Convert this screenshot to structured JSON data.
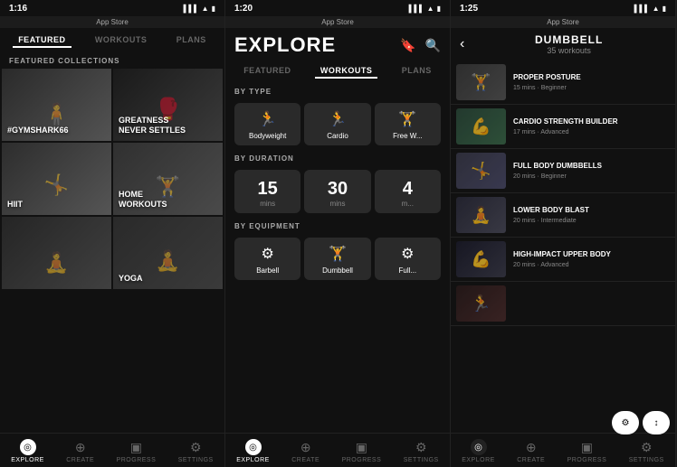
{
  "panels": [
    {
      "id": "panel1",
      "statusBar": {
        "time": "1:16",
        "carrier": "App Store"
      },
      "navTabs": [
        {
          "label": "FEATURED",
          "active": true
        },
        {
          "label": "WORKOUTS",
          "active": false
        },
        {
          "label": "PLANS",
          "active": false
        }
      ],
      "sectionLabel": "FEATURED COLLECTIONS",
      "cards": [
        {
          "label": "#GYMSHARK66",
          "bgClass": "bg-gymshark"
        },
        {
          "label": "GREATNESS\nNEVER SETTLES",
          "bgClass": "bg-greatness"
        },
        {
          "label": "HIIT",
          "bgClass": "bg-hiit"
        },
        {
          "label": "HOME\nWORKOUTS",
          "bgClass": "bg-home"
        },
        {
          "label": "",
          "bgClass": "bg-yoga"
        },
        {
          "label": "YOGA",
          "bgClass": "bg-extra"
        }
      ],
      "bottomNav": [
        {
          "label": "EXPLORE",
          "icon": "⊙",
          "active": true
        },
        {
          "label": "CREATE",
          "icon": "⊕",
          "active": false
        },
        {
          "label": "PROGRESS",
          "icon": "▣",
          "active": false
        },
        {
          "label": "SETTINGS",
          "icon": "⚙",
          "active": false
        }
      ]
    },
    {
      "id": "panel2",
      "statusBar": {
        "time": "1:20",
        "carrier": "App Store"
      },
      "title": "EXPLORE",
      "navTabs": [
        {
          "label": "FEATURED",
          "active": false
        },
        {
          "label": "WORKOUTS",
          "active": true
        },
        {
          "label": "PLANS",
          "active": false
        }
      ],
      "sections": {
        "byType": {
          "label": "BY TYPE",
          "items": [
            {
              "icon": "🏃",
              "label": "Bodyweight"
            },
            {
              "icon": "🏃",
              "label": "Cardio"
            },
            {
              "icon": "🏋",
              "label": "Free W..."
            }
          ]
        },
        "byDuration": {
          "label": "BY DURATION",
          "items": [
            {
              "num": "15",
              "unit": "mins"
            },
            {
              "num": "30",
              "unit": "mins"
            },
            {
              "num": "4",
              "unit": "m..."
            }
          ]
        },
        "byEquipment": {
          "label": "BY EQUIPMENT",
          "items": [
            {
              "icon": "⚔",
              "label": "Barbell"
            },
            {
              "icon": "🏋",
              "label": "Dumbbell"
            },
            {
              "icon": "⚔",
              "label": "Full..."
            }
          ]
        }
      },
      "bottomNav": [
        {
          "label": "EXPLORE",
          "icon": "⊙",
          "active": true
        },
        {
          "label": "CREATE",
          "icon": "⊕",
          "active": false
        },
        {
          "label": "PROGRESS",
          "icon": "▣",
          "active": false
        },
        {
          "label": "SETTINGS",
          "icon": "⚙",
          "active": false
        }
      ]
    },
    {
      "id": "panel3",
      "statusBar": {
        "time": "1:25",
        "carrier": "App Store"
      },
      "title": "DUMBBELL",
      "subtitle": "35 workouts",
      "workouts": [
        {
          "name": "PROPER POSTURE",
          "duration": "15 mins",
          "level": "Beginner",
          "bgClass": "thumb-1"
        },
        {
          "name": "CARDIO STRENGTH BUILDER",
          "duration": "17 mins",
          "level": "Advanced",
          "bgClass": "thumb-2"
        },
        {
          "name": "FULL BODY DUMBBELLS",
          "duration": "20 mins",
          "level": "Beginner",
          "bgClass": "thumb-3"
        },
        {
          "name": "LOWER BODY BLAST",
          "duration": "20 mins",
          "level": "Intermediate",
          "bgClass": "thumb-4"
        },
        {
          "name": "HIGH-IMPACT UPPER BODY",
          "duration": "20 mins",
          "level": "Advanced",
          "bgClass": "thumb-5"
        },
        {
          "name": "...",
          "duration": "",
          "level": "",
          "bgClass": "thumb-6"
        }
      ],
      "filterButtons": [
        "⚙",
        "↕"
      ],
      "bottomNav": [
        {
          "label": "EXPLORE",
          "icon": "⊙",
          "active": false
        },
        {
          "label": "CREATE",
          "icon": "⊕",
          "active": false
        },
        {
          "label": "PROGRESS",
          "icon": "▣",
          "active": false
        },
        {
          "label": "SETTINGS",
          "icon": "⚙",
          "active": false
        }
      ]
    }
  ]
}
